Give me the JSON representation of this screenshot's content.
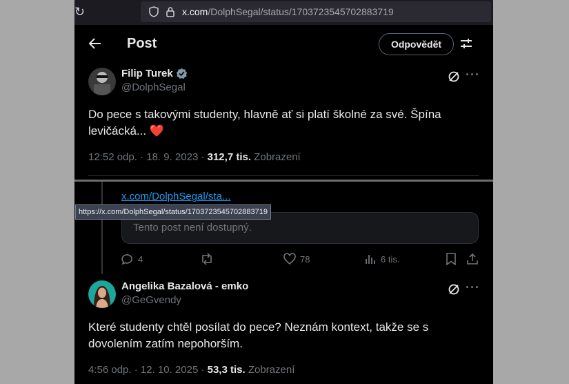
{
  "browser": {
    "url_domain": "x.com",
    "url_path": "/DolphSegal/status/1703723545702883719"
  },
  "header": {
    "title": "Post",
    "reply_button": "Odpovědět"
  },
  "main_post": {
    "name": "Filip Turek",
    "handle": "@DolphSegal",
    "text": "Do pece s takovými studenty, hlavně ať si platí školné za své. Špína levičácká... ",
    "emoji": "❤️",
    "time_date": "12:52 odp. · 18. 9. 2023 · ",
    "views": "312,7 tis.",
    "views_label": " Zobrazení"
  },
  "quote": {
    "link": "x.com/DolphSegal/sta...",
    "unavailable": "Tento post není dostupný."
  },
  "actions": {
    "replies": "4",
    "likes": "78",
    "views": "6 tis."
  },
  "tooltip": "https://x.com/DolphSegal/status/1703723545702883719",
  "reply_post": {
    "name": "Angelika Bazalová - emko",
    "handle": "@GeGvendy",
    "text": "Které studenty chtěl posílat do pece? Neznám kontext, takže se s dovolením zatím nepohorším.",
    "time_date": "4:56 odp. · 12. 10. 2025 · ",
    "views": "53,3 tis.",
    "views_label": " Zobrazení"
  },
  "colors": {
    "background": "#000000",
    "text": "#e7e9ea",
    "muted": "#71767b",
    "link": "#1d9bf0",
    "verified": "#829aab",
    "heart": "#e0245e"
  }
}
